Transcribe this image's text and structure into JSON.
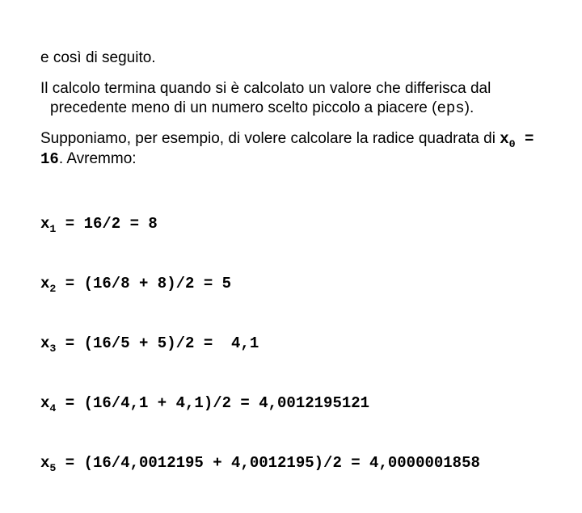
{
  "p1": "e così di seguito.",
  "p2_a": "Il calcolo termina quando si è calcolato un valore che differisca dal precedente meno di un numero scelto piccolo a piacere (",
  "p2_eps": "eps",
  "p2_b": ").",
  "supp_a": "Supponiamo, per esempio, di volere calcolare la radice quadrata di ",
  "supp_x0": "x",
  "supp_sub0": "0",
  "supp_eq": " = 16",
  "supp_b": ". Avremmo:",
  "lines": {
    "l1": {
      "label": "x",
      "sub": "1",
      "rest": " = 16/2 = 8"
    },
    "l2": {
      "label": "x",
      "sub": "2",
      "rest": " = (16/8 + 8)/2 = 5"
    },
    "l3": {
      "label": "x",
      "sub": "3",
      "rest": " = (16/5 + 5)/2 =  4,1"
    },
    "l4": {
      "label": "x",
      "sub": "4",
      "rest": " = (16/4,1 + 4,1)/2 = 4,0012195121"
    },
    "l5": {
      "label": "x",
      "sub": "5",
      "rest": " = (16/4,0012195 + 4,0012195)/2 = 4,0000001858"
    }
  }
}
